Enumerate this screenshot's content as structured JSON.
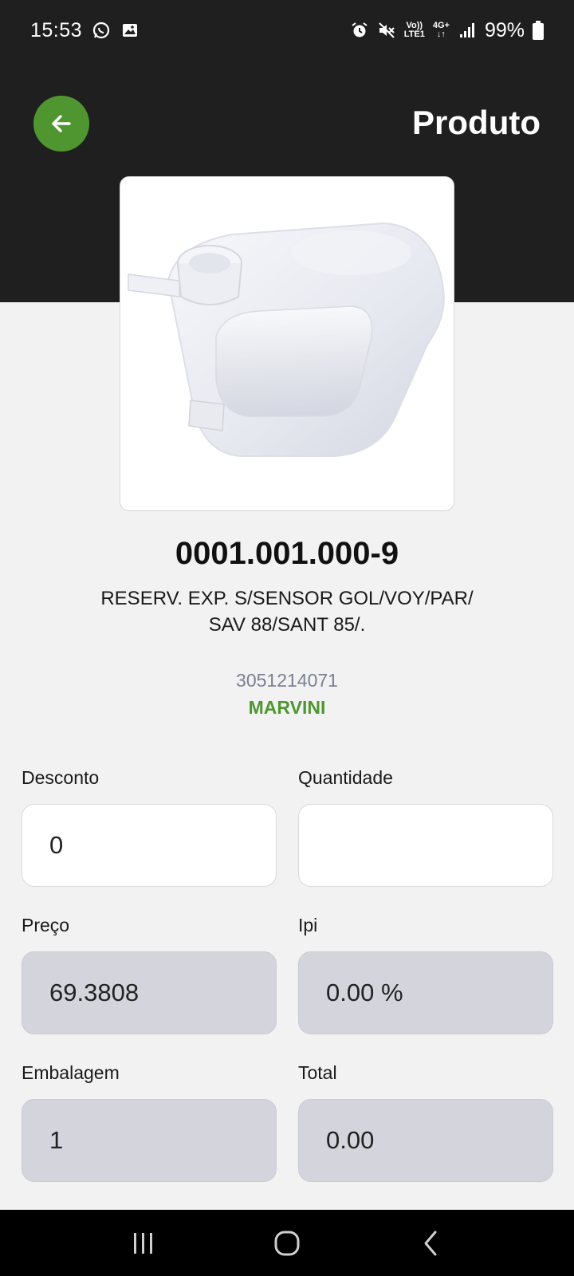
{
  "status_bar": {
    "time": "15:53",
    "battery": "99%",
    "left_icons": [
      "whatsapp-icon",
      "gallery-icon"
    ],
    "right_icons": [
      "alarm-icon",
      "mute-icon",
      "volte-icon",
      "4g-icon",
      "signal-icon",
      "battery-icon"
    ],
    "volte_label_top": "Vo))",
    "volte_label_bottom": "LTE1",
    "network_label": "4G+"
  },
  "header": {
    "title": "Produto",
    "back_icon": "arrow-left-icon",
    "accent_color": "#4f9630",
    "background_color": "#1f1f1f"
  },
  "product": {
    "image_alt": "Expansion reservoir tank",
    "code": "0001.001.000-9",
    "description": "RESERV. EXP. S/SENSOR GOL/VOY/PAR/ SAV 88/SANT 85/.",
    "reference": "3051214071",
    "brand": "MARVINI",
    "brand_color": "#4f9630"
  },
  "form": {
    "desconto": {
      "label": "Desconto",
      "value": "0"
    },
    "quantidade": {
      "label": "Quantidade",
      "value": ""
    },
    "preco": {
      "label": "Preço",
      "value": "69.3808"
    },
    "ipi": {
      "label": "Ipi",
      "value": "0.00 %"
    },
    "embalagem": {
      "label": "Embalagem",
      "value": "1"
    },
    "total": {
      "label": "Total",
      "value": "0.00"
    }
  },
  "nav_bar": {
    "icons": [
      "recent-apps-icon",
      "home-icon",
      "back-nav-icon"
    ]
  }
}
